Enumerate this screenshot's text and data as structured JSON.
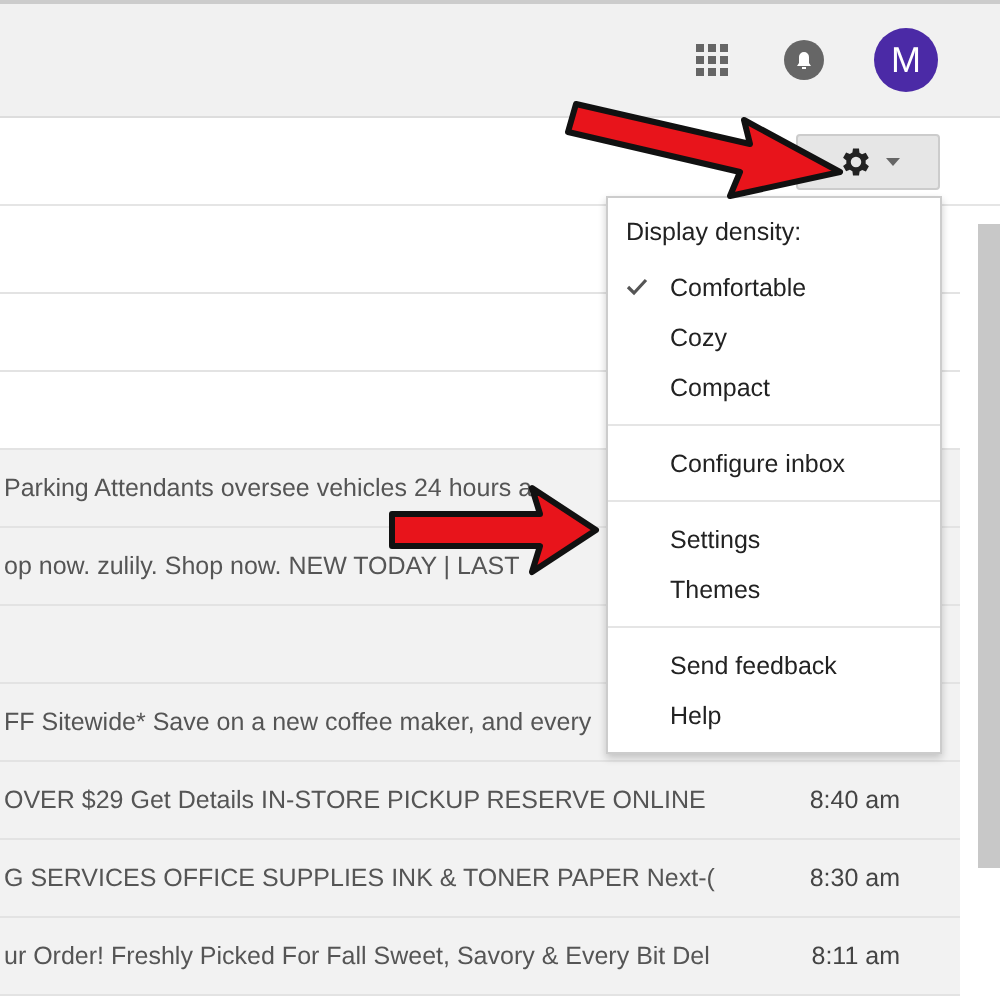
{
  "header": {
    "avatar_letter": "M"
  },
  "toolbar": {
    "settings_button": {
      "selected": true
    }
  },
  "rows": [
    {
      "read": false
    },
    {
      "read": false
    },
    {
      "read": false
    },
    {
      "read": true,
      "snippet": "Parking Attendants oversee vehicles 24 hours a"
    },
    {
      "read": true,
      "snippet": "op now. zulily. Shop now. NEW TODAY | LAST"
    },
    {
      "read": true
    },
    {
      "read": true,
      "snippet": "FF Sitewide* Save on a new coffee maker, and every"
    },
    {
      "read": true,
      "snippet": "OVER $29 Get Details IN-STORE PICKUP RESERVE ONLINE",
      "time": "8:40 am"
    },
    {
      "read": true,
      "snippet": "G SERVICES OFFICE SUPPLIES INK & TONER PAPER Next-(",
      "time": "8:30 am"
    },
    {
      "read": true,
      "snippet": "ur Order! Freshly Picked For Fall Sweet, Savory & Every Bit Del",
      "time": "8:11 am"
    }
  ],
  "menu": {
    "sections": [
      {
        "heading": "Display density:",
        "items": [
          {
            "label": "Comfortable",
            "checked": true
          },
          {
            "label": "Cozy",
            "checked": false
          },
          {
            "label": "Compact",
            "checked": false
          }
        ]
      },
      {
        "items": [
          {
            "label": "Configure inbox"
          }
        ]
      },
      {
        "items": [
          {
            "label": "Settings"
          },
          {
            "label": "Themes"
          }
        ]
      },
      {
        "items": [
          {
            "label": "Send feedback"
          },
          {
            "label": "Help"
          }
        ]
      }
    ]
  }
}
